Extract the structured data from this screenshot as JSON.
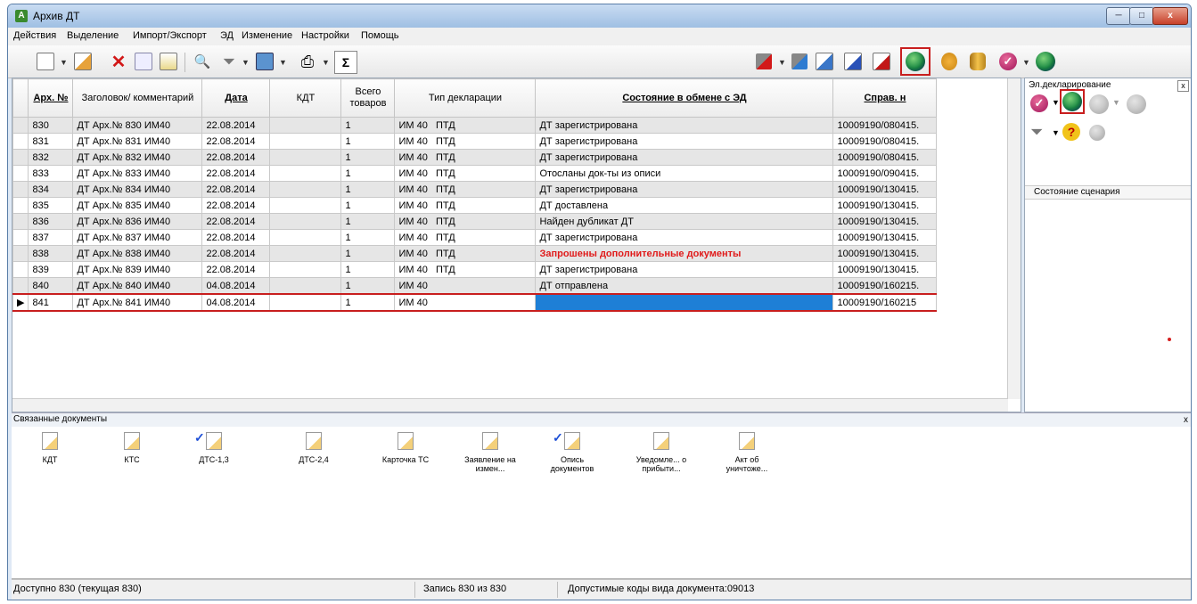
{
  "window": {
    "title": "Архив ДТ",
    "app_icon": "app-icon",
    "min": "─",
    "max": "□",
    "close": "x"
  },
  "menu": [
    "Действия",
    "Выделение",
    "Импорт/Экспорт",
    "ЭД",
    "Изменение",
    "Настройки",
    "Помощь"
  ],
  "toolbar": {
    "sum_symbol": "Σ",
    "find_symbol": "🔍"
  },
  "grid": {
    "headers": {
      "arch_no": "Арх. №",
      "title": "Заголовок/ комментарий",
      "date": "Дата",
      "kdt": "КДТ",
      "total_goods": "Всего товаров",
      "decl_type": "Тип декларации",
      "ed_state": "Состояние в обмене с ЭД",
      "ref": "Справ. н"
    },
    "rows": [
      {
        "no": "830",
        "title": "ДТ Арх.№ 830 ИМ40",
        "date": "22.08.2014",
        "kdt": "",
        "goods": "1",
        "type": "ИМ 40",
        "ptd": "ПТД",
        "state": "ДТ зарегистрирована",
        "ref": "10009190/080415."
      },
      {
        "no": "831",
        "title": "ДТ Арх.№ 831 ИМ40",
        "date": "22.08.2014",
        "kdt": "",
        "goods": "1",
        "type": "ИМ 40",
        "ptd": "ПТД",
        "state": "ДТ зарегистрирована",
        "ref": "10009190/080415."
      },
      {
        "no": "832",
        "title": "ДТ Арх.№ 832 ИМ40",
        "date": "22.08.2014",
        "kdt": "",
        "goods": "1",
        "type": "ИМ 40",
        "ptd": "ПТД",
        "state": "ДТ зарегистрирована",
        "ref": "10009190/080415."
      },
      {
        "no": "833",
        "title": "ДТ Арх.№ 833 ИМ40",
        "date": "22.08.2014",
        "kdt": "",
        "goods": "1",
        "type": "ИМ 40",
        "ptd": "ПТД",
        "state": "Отосланы док-ты из описи",
        "ref": "10009190/090415."
      },
      {
        "no": "834",
        "title": "ДТ Арх.№ 834 ИМ40",
        "date": "22.08.2014",
        "kdt": "",
        "goods": "1",
        "type": "ИМ 40",
        "ptd": "ПТД",
        "state": "ДТ зарегистрирована",
        "ref": "10009190/130415."
      },
      {
        "no": "835",
        "title": "ДТ Арх.№ 835 ИМ40",
        "date": "22.08.2014",
        "kdt": "",
        "goods": "1",
        "type": "ИМ 40",
        "ptd": "ПТД",
        "state": "ДТ доставлена",
        "ref": "10009190/130415."
      },
      {
        "no": "836",
        "title": "ДТ Арх.№ 836 ИМ40",
        "date": "22.08.2014",
        "kdt": "",
        "goods": "1",
        "type": "ИМ 40",
        "ptd": "ПТД",
        "state": "Найден дубликат ДТ",
        "ref": "10009190/130415."
      },
      {
        "no": "837",
        "title": "ДТ Арх.№ 837 ИМ40",
        "date": "22.08.2014",
        "kdt": "",
        "goods": "1",
        "type": "ИМ 40",
        "ptd": "ПТД",
        "state": "ДТ зарегистрирована",
        "ref": "10009190/130415."
      },
      {
        "no": "838",
        "title": "ДТ Арх.№ 838 ИМ40",
        "date": "22.08.2014",
        "kdt": "",
        "goods": "1",
        "type": "ИМ 40",
        "ptd": "ПТД",
        "state": "Запрошены дополнительные документы",
        "ref": "10009190/130415."
      },
      {
        "no": "839",
        "title": "ДТ Арх.№ 839 ИМ40",
        "date": "22.08.2014",
        "kdt": "",
        "goods": "1",
        "type": "ИМ 40",
        "ptd": "ПТД",
        "state": "ДТ зарегистрирована",
        "ref": "10009190/130415."
      },
      {
        "no": "840",
        "title": "ДТ Арх.№ 840 ИМ40",
        "date": "04.08.2014",
        "kdt": "",
        "goods": "1",
        "type": "ИМ 40",
        "ptd": "",
        "state": "ДТ отправлена",
        "ref": "10009190/160215."
      },
      {
        "no": "841",
        "title": "ДТ Арх.№ 841 ИМ40",
        "date": "04.08.2014",
        "kdt": "",
        "goods": "1",
        "type": "ИМ 40",
        "ptd": "",
        "state": "",
        "ref": "10009190/160215"
      }
    ],
    "current_row_marker": "▶"
  },
  "right_panel": {
    "title": "Эл.декларирование",
    "close": "x",
    "state_label": "Состояние сценария"
  },
  "linked": {
    "title": "Связанные документы",
    "close": "x",
    "docs": [
      {
        "label": "КДТ",
        "checked": false
      },
      {
        "label": "КТС",
        "checked": false
      },
      {
        "label": "ДТС-1,3",
        "checked": true
      },
      {
        "label": "ДТС-2,4",
        "checked": false
      },
      {
        "label": "Карточка ТС",
        "checked": false
      },
      {
        "label": "Заявление на измен...",
        "checked": false
      },
      {
        "label": "Опись документов",
        "checked": true
      },
      {
        "label": "Уведомле... о прибыти...",
        "checked": false
      },
      {
        "label": "Акт об уничтоже...",
        "checked": false
      }
    ]
  },
  "status": {
    "available": "Доступно 830 (текущая 830)",
    "record": "Запись 830 из 830",
    "codes": "Допустимые коды вида документа:09013"
  },
  "colors": {
    "selection": "#1e7fd6",
    "highlight": "#c81e1e",
    "warning_text": "#e01b1b"
  }
}
